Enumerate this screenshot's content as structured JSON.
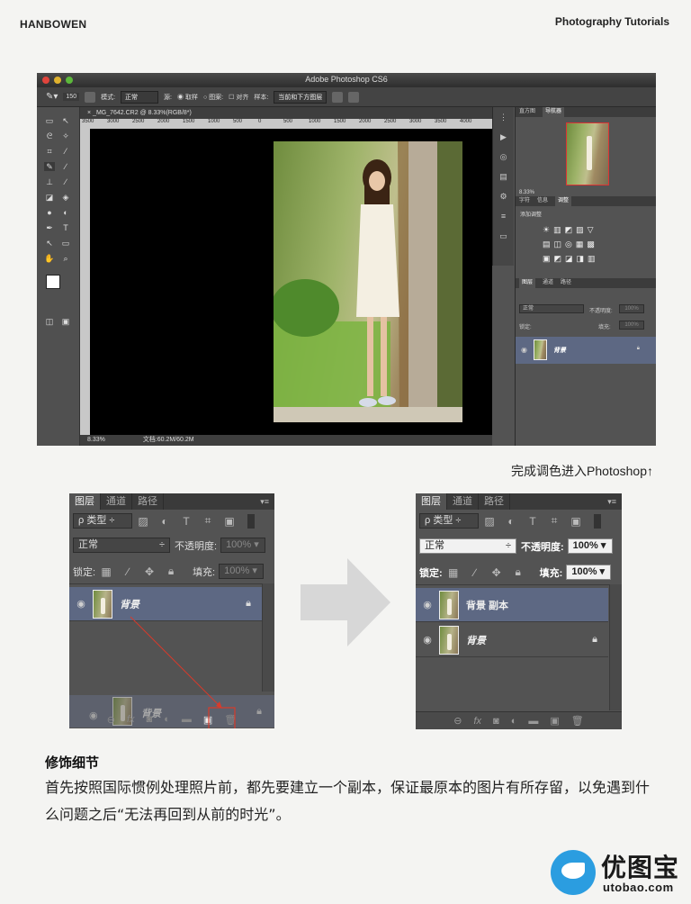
{
  "header": {
    "left": "HANBOWEN",
    "right": "Photography Tutorials"
  },
  "photoshop": {
    "app_title": "Adobe Photoshop CS6",
    "options": {
      "brush_size": "150",
      "mode_label": "模式:",
      "mode_value": "正常",
      "source_label": "源:",
      "source_sample": "取样",
      "source_pattern": "图案:",
      "align_label": "对齐",
      "sample_label": "样本:",
      "sample_value": "当前和下方图层"
    },
    "doc_tab": "_MG_7642.CR2 @ 8.33%(RGB/8*)",
    "ruler_ticks": [
      "3500",
      "3000",
      "2500",
      "2000",
      "1500",
      "1000",
      "500",
      "0",
      "500",
      "1000",
      "1500",
      "2000",
      "2500",
      "3000",
      "3500",
      "4000"
    ],
    "status": {
      "zoom": "8.33%",
      "doc": "文档:60.2M/60.2M"
    },
    "right_panel": {
      "nav_tabs": [
        "直方图",
        "导航器"
      ],
      "nav_zoom": "8.33%",
      "adj_tabs": [
        "字符",
        "信息",
        "调整"
      ],
      "adj_title": "添加调整",
      "layers_tabs": [
        "图层",
        "通道",
        "路径"
      ],
      "blend": "正常",
      "opacity_label": "不透明度:",
      "opacity": "100%",
      "lock_label": "锁定:",
      "fill_label": "填充:",
      "fill": "100%",
      "layer_name": "背景"
    }
  },
  "caption": "完成调色进入Photoshop↑",
  "panel_before": {
    "tabs": [
      "图层",
      "通道",
      "路径"
    ],
    "filter_label": "ρ 类型",
    "blend": "正常",
    "opacity_label": "不透明度:",
    "opacity": "100%",
    "lock_label": "锁定:",
    "fill_label": "填充:",
    "fill": "100%",
    "layer": "背景",
    "ghost_layer": "背景"
  },
  "panel_after": {
    "tabs": [
      "图层",
      "通道",
      "路径"
    ],
    "filter_label": "ρ 类型",
    "blend": "正常",
    "opacity_label": "不透明度:",
    "opacity": "100%",
    "lock_label": "锁定:",
    "fill_label": "填充:",
    "fill": "100%",
    "layers": [
      "背景 副本",
      "背景"
    ]
  },
  "section": {
    "title": "修饰细节",
    "body": "首先按照国际惯例处理照片前，都先要建立一个副本，保证最原本的图片有所存留，以免遇到什么问题之后“无法再回到从前的时光”。"
  },
  "logo": {
    "name": "优图宝",
    "url": "utobao.com"
  },
  "colors": {
    "panel": "#535353",
    "selected_layer": "#5d6883",
    "highlight": "#d83b2b",
    "logo_blue": "#2b9de0"
  }
}
